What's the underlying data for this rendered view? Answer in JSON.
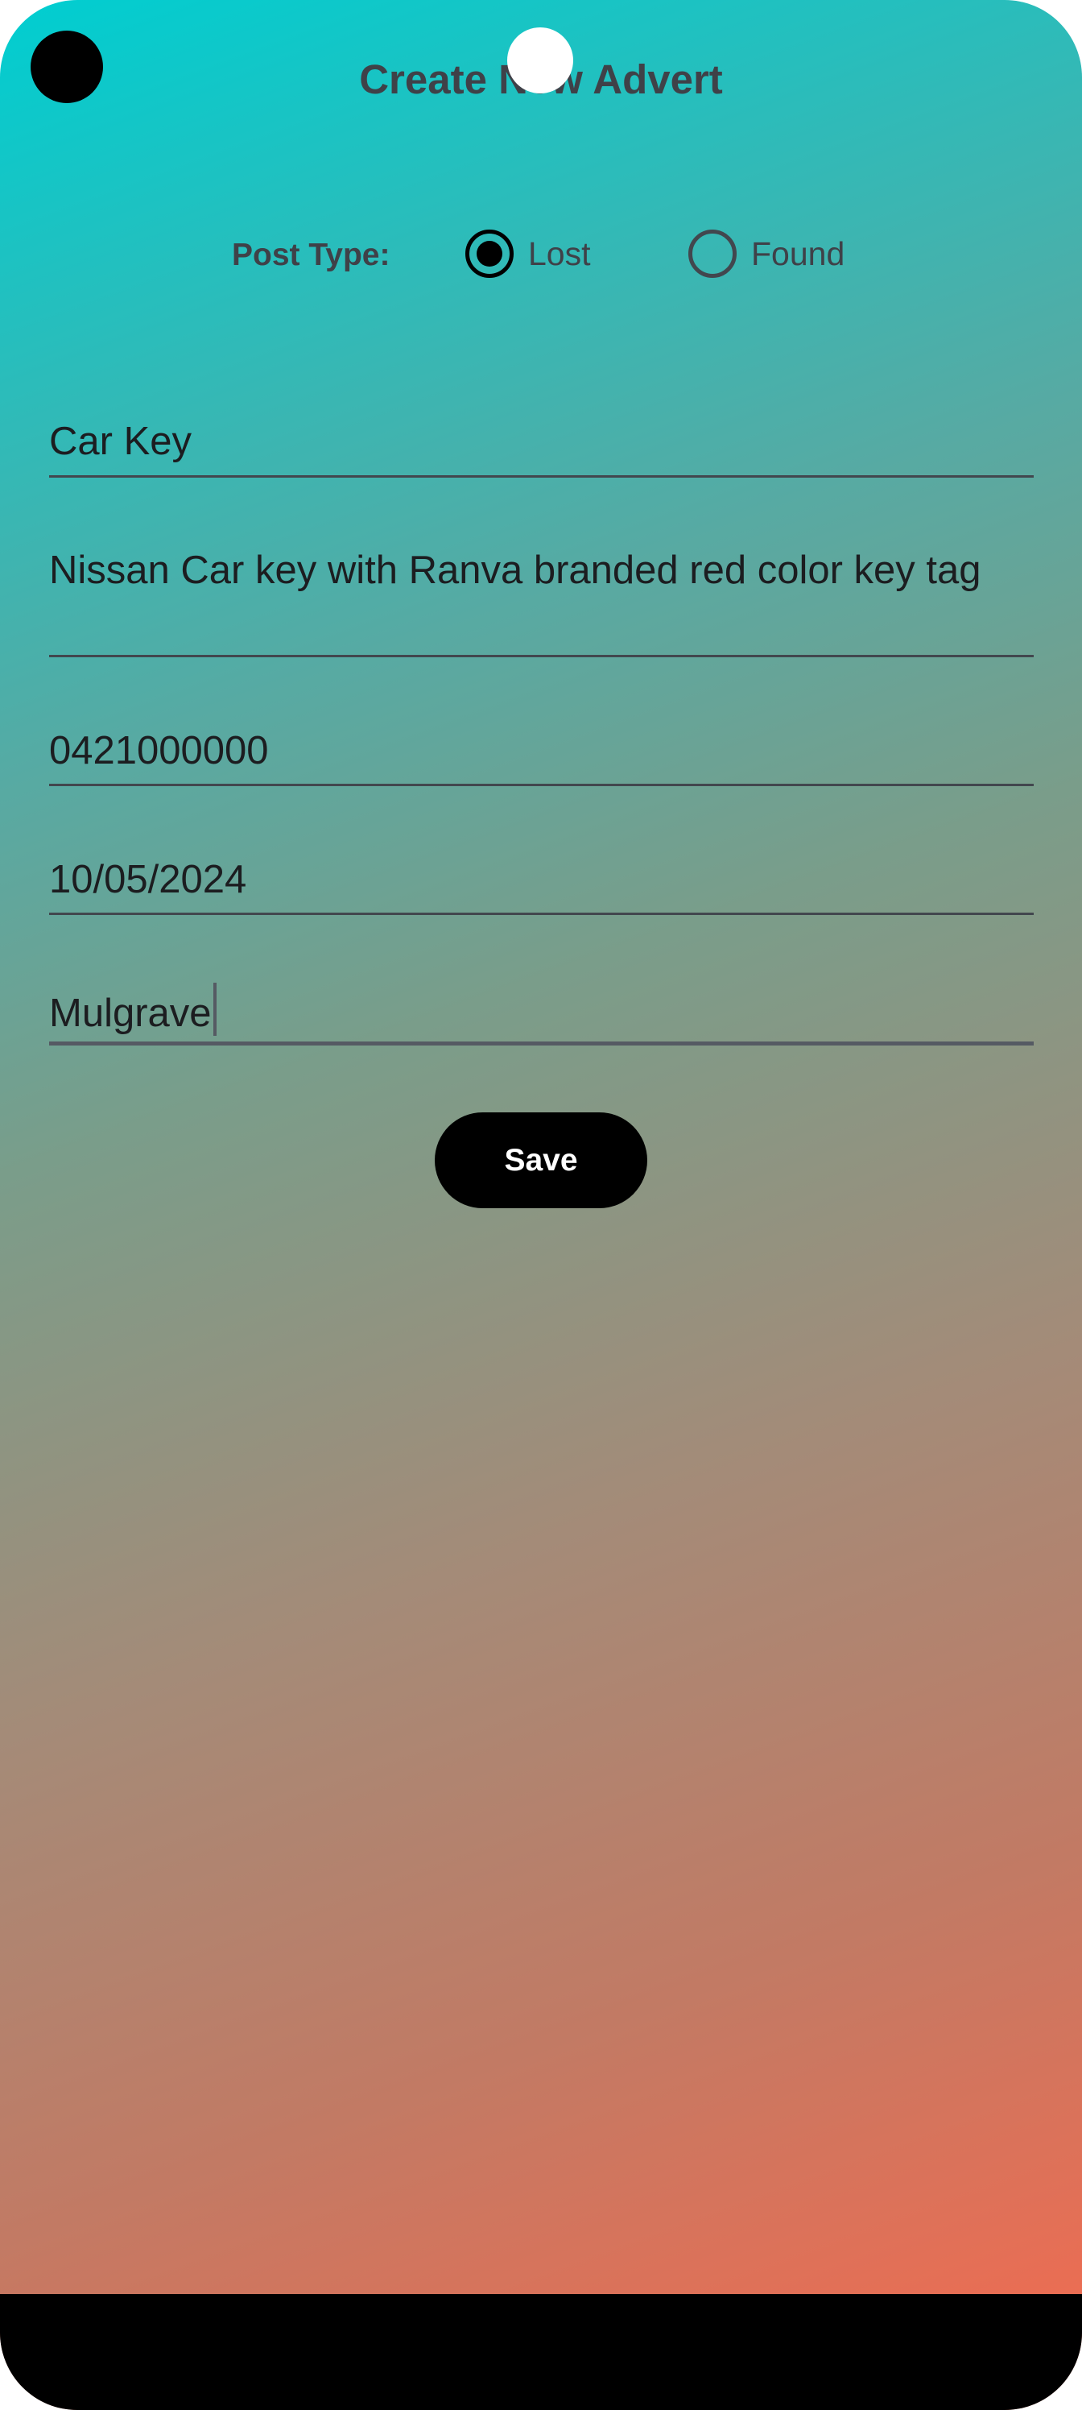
{
  "header": {
    "title": "Create New Advert"
  },
  "post_type": {
    "label": "Post Type:",
    "options": [
      {
        "label": "Lost",
        "selected": true
      },
      {
        "label": "Found",
        "selected": false
      }
    ]
  },
  "form": {
    "item_name": "Car Key",
    "description": "Nissan Car key with Ranva branded red color key tag",
    "phone": "0421000000",
    "date": "10/05/2024",
    "location": "Mulgrave"
  },
  "actions": {
    "save_label": "Save"
  },
  "colors": {
    "gradient_start": "#00ced1",
    "gradient_end": "#f56a4f",
    "title_text": "#3f4148",
    "button_bg": "#000000",
    "button_text": "#ffffff"
  }
}
